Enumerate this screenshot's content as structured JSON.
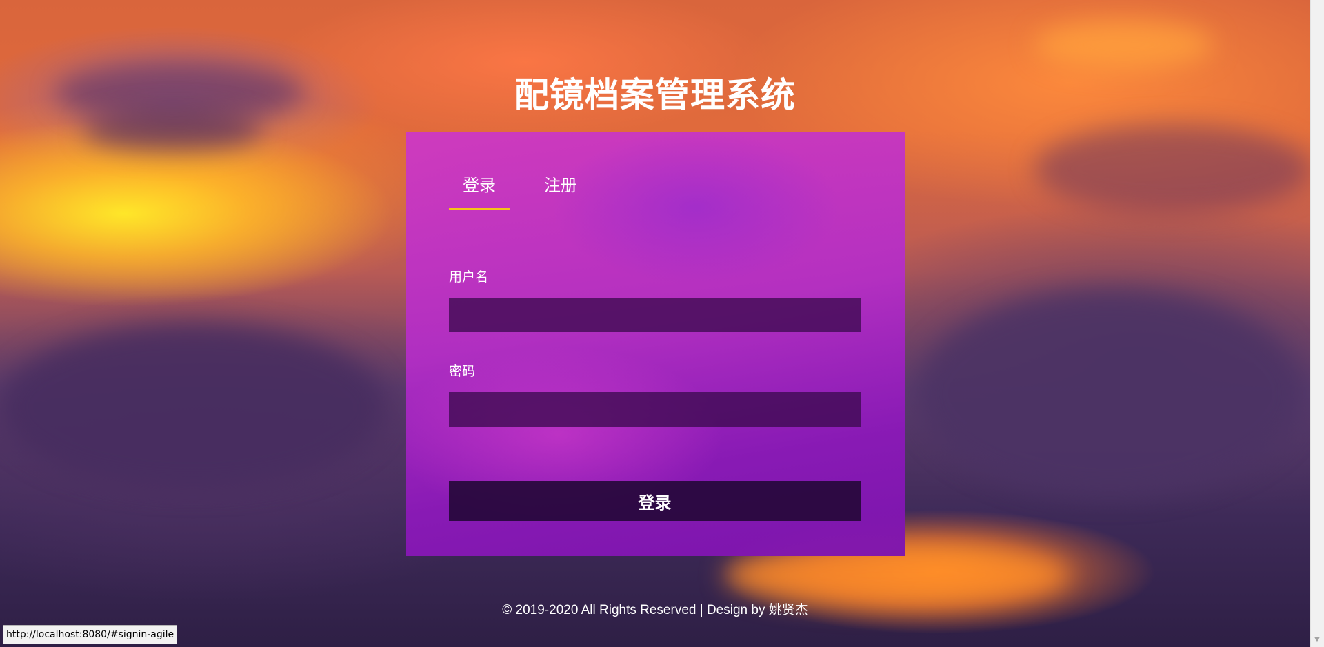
{
  "page": {
    "title": "配镜档案管理系统"
  },
  "tabs": [
    {
      "label": "登录",
      "active": true
    },
    {
      "label": "注册",
      "active": false
    }
  ],
  "form": {
    "username_label": "用户名",
    "username_value": "",
    "password_label": "密码",
    "password_value": "",
    "submit_label": "登录"
  },
  "footer": {
    "text": "© 2019-2020 All Rights Reserved | Design by 姚贤杰"
  },
  "browser": {
    "status_url": "http://localhost:8080/#signin-agile"
  },
  "colors": {
    "accent": "#f5c518",
    "card": "#b52fc8",
    "input_bg": "#4a0d5e",
    "button_bg": "#2a0a3a"
  }
}
